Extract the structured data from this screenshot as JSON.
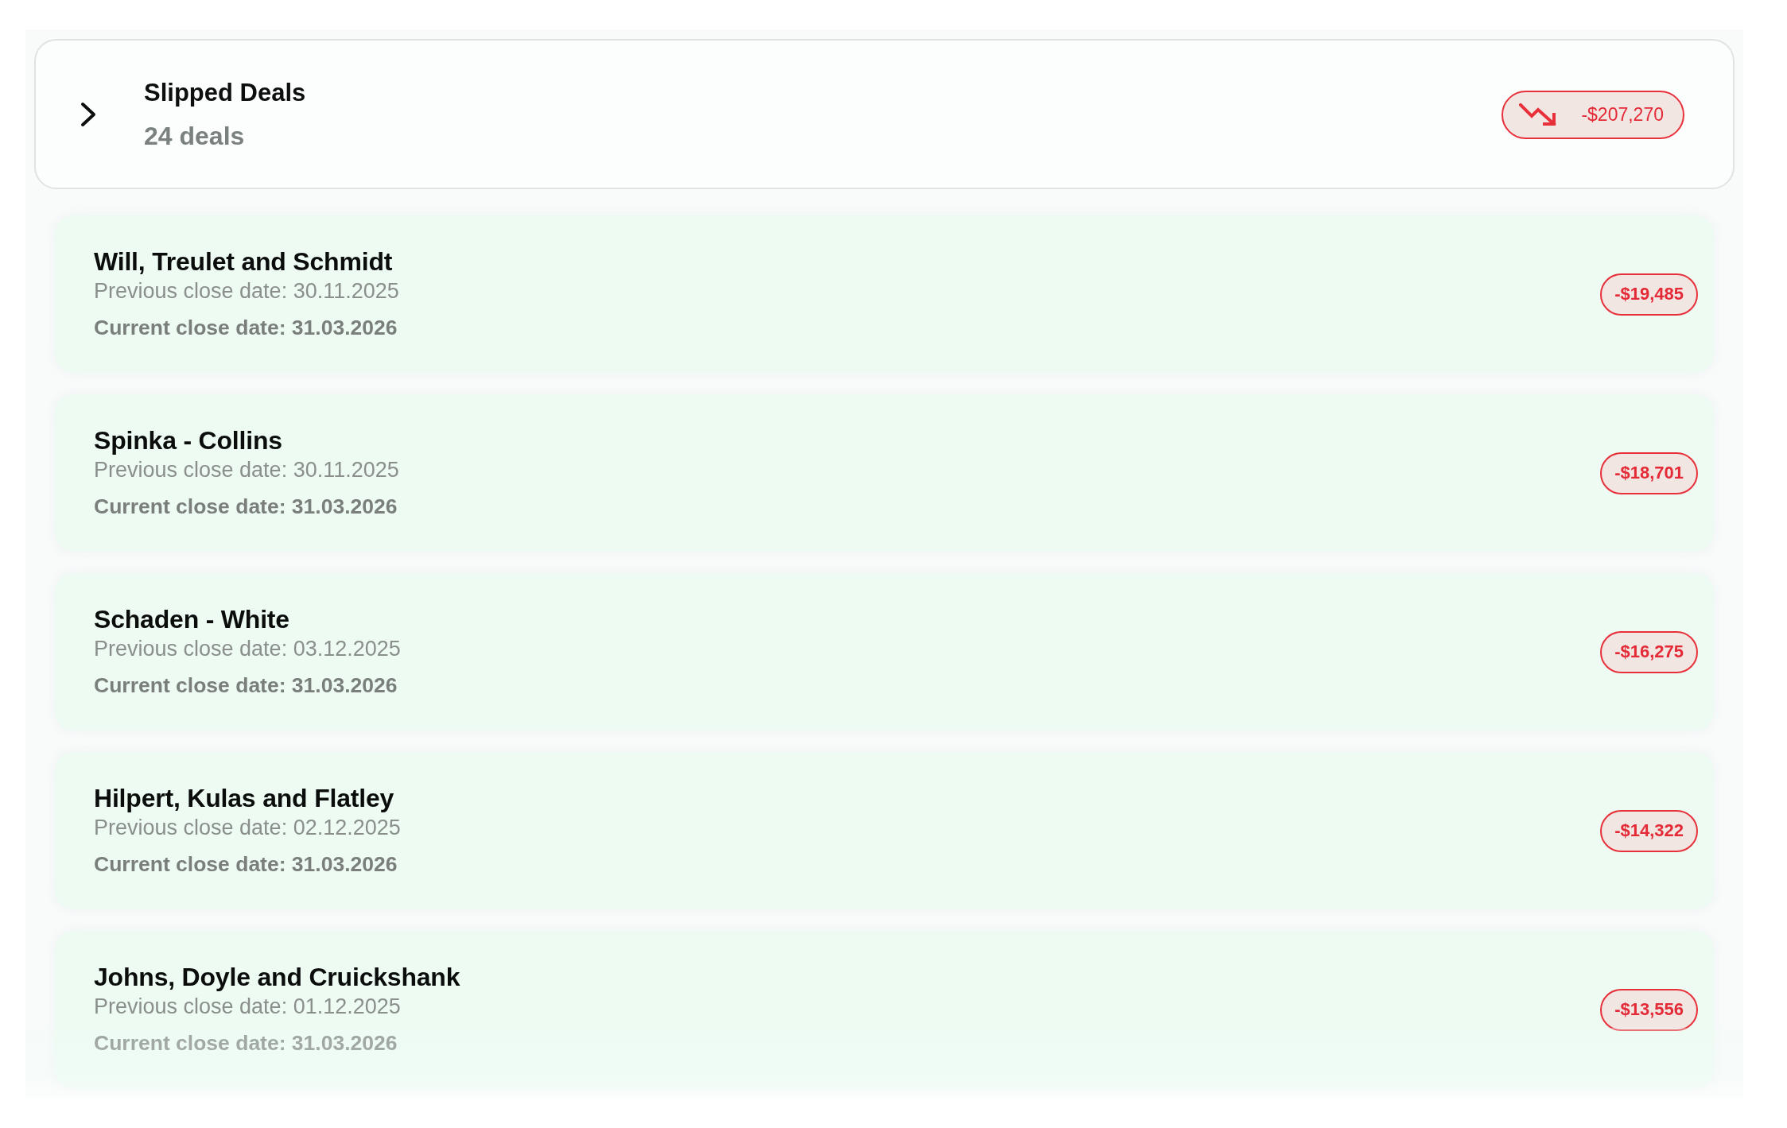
{
  "group": {
    "title": "Slipped Deals",
    "count": "24 deals",
    "expanded": false,
    "total": "-$207,270"
  },
  "deals": [
    {
      "name": "Will, Treulet and Schmidt",
      "previous": "Previous close date: 30.11.2025",
      "current": "Current close date: 31.03.2026",
      "amount": "-$19,485"
    },
    {
      "name": "Spinka - Collins",
      "previous": "Previous close date: 30.11.2025",
      "current": "Current close date: 31.03.2026",
      "amount": "-$18,701"
    },
    {
      "name": "Schaden - White",
      "previous": "Previous close date: 03.12.2025",
      "current": "Current close date: 31.03.2026",
      "amount": "-$16,275"
    },
    {
      "name": "Hilpert, Kulas and Flatley",
      "previous": "Previous close date: 02.12.2025",
      "current": "Current close date: 31.03.2026",
      "amount": "-$14,322"
    },
    {
      "name": "Johns, Doyle and Cruickshank",
      "previous": "Previous close date: 01.12.2025",
      "current": "Current close date: 31.03.2026",
      "amount": "-$13,556"
    }
  ]
}
